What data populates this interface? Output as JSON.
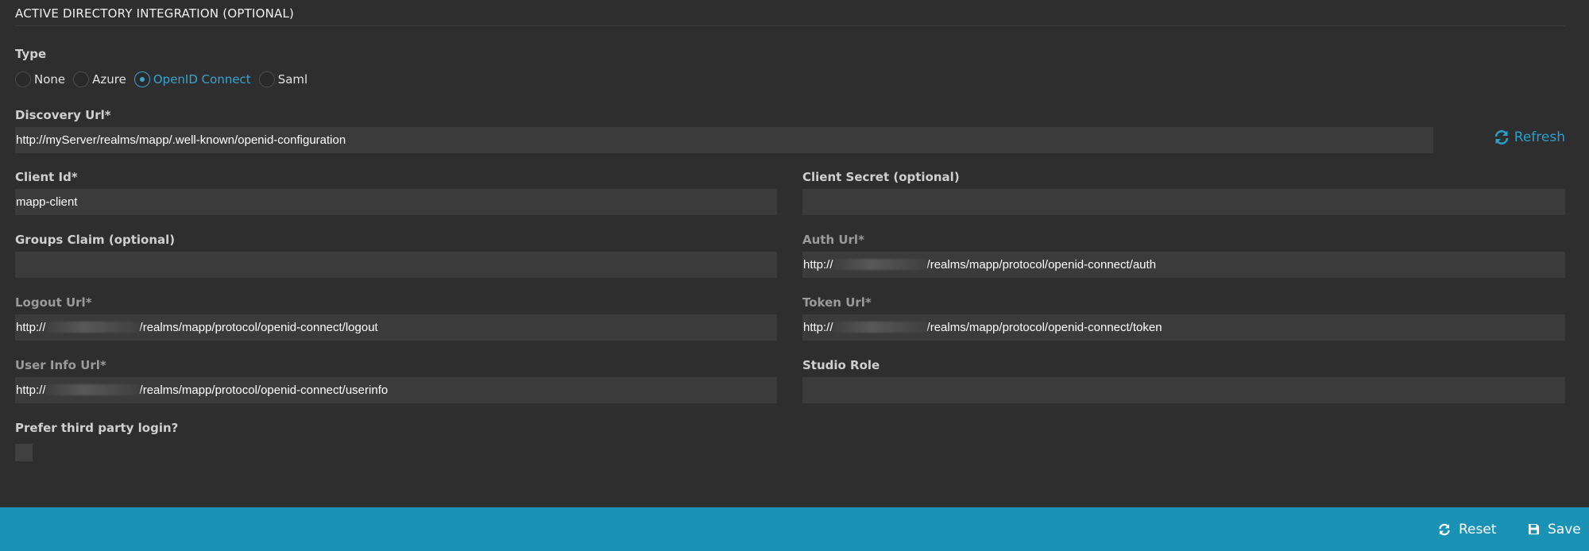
{
  "section": {
    "title": "ACTIVE DIRECTORY INTEGRATION (OPTIONAL)"
  },
  "type": {
    "label": "Type",
    "options": [
      "None",
      "Azure",
      "OpenID Connect",
      "Saml"
    ],
    "selected": "OpenID Connect"
  },
  "discovery": {
    "label": "Discovery Url*",
    "value": "http://myServer/realms/mapp/.well-known/openid-configuration",
    "refresh_label": "Refresh"
  },
  "client_id": {
    "label": "Client Id*",
    "value": "mapp-client"
  },
  "client_secret": {
    "label": "Client Secret (optional)",
    "value": ""
  },
  "groups_claim": {
    "label": "Groups Claim (optional)",
    "value": ""
  },
  "auth_url": {
    "label": "Auth Url*",
    "prefix": "http://",
    "suffix": "/realms/mapp/protocol/openid-connect/auth"
  },
  "logout_url": {
    "label": "Logout Url*",
    "prefix": "http://",
    "suffix": "/realms/mapp/protocol/openid-connect/logout"
  },
  "token_url": {
    "label": "Token Url*",
    "prefix": "http://",
    "suffix": "/realms/mapp/protocol/openid-connect/token"
  },
  "userinfo_url": {
    "label": "User Info Url*",
    "prefix": "http://",
    "suffix": "/realms/mapp/protocol/openid-connect/userinfo"
  },
  "studio_role": {
    "label": "Studio Role",
    "value": ""
  },
  "prefer_third_party": {
    "label": "Prefer third party login?",
    "checked": false
  },
  "footer": {
    "reset_label": "Reset",
    "save_label": "Save"
  },
  "colors": {
    "accent": "#27a0cc",
    "footer": "#1a92b6",
    "background": "#2e2e2e",
    "field": "#3b3b3b"
  }
}
